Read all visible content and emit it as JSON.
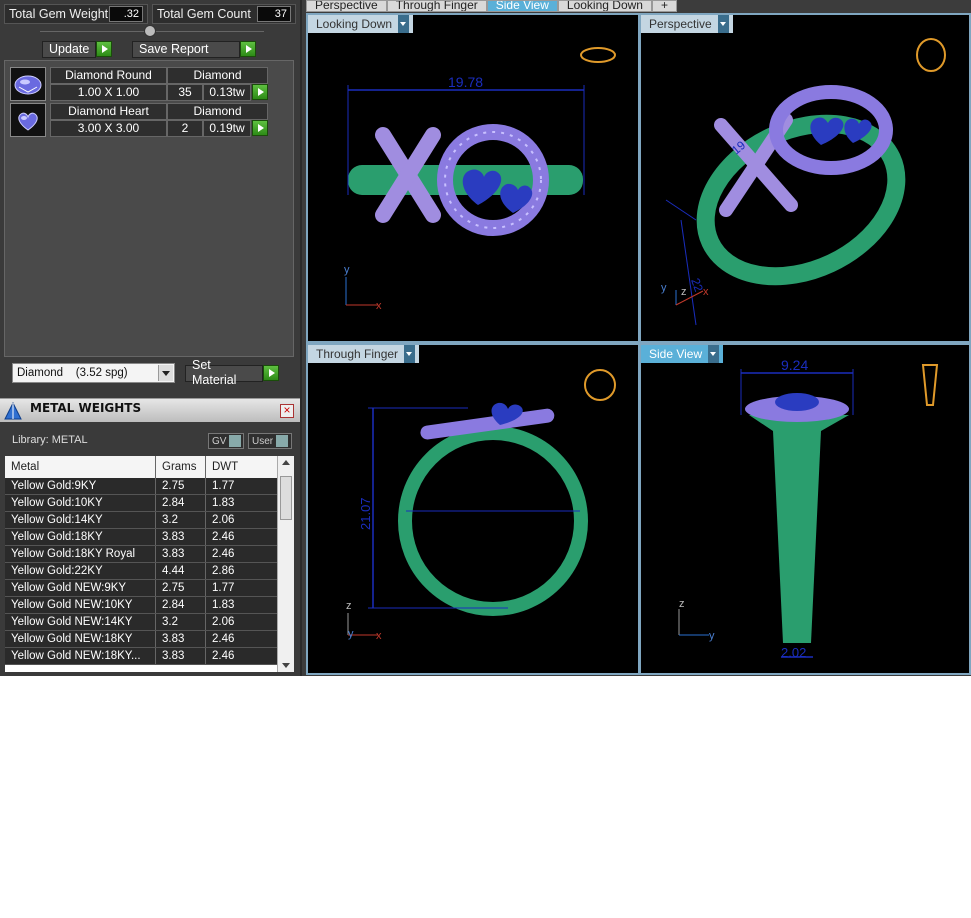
{
  "totals": {
    "weight_label": "Total Gem Weight",
    "weight_value": ".32",
    "count_label": "Total Gem Count",
    "count_value": "37"
  },
  "actions": {
    "update_label": "Update",
    "save_report_label": "Save Report"
  },
  "gems": [
    {
      "name": "Diamond Round",
      "material": "Diamond",
      "size": "1.00 X 1.00",
      "count": "35",
      "weight": "0.13tw"
    },
    {
      "name": "Diamond Heart",
      "material": "Diamond",
      "size": "3.00 X 3.00",
      "count": "2",
      "weight": "0.19tw"
    }
  ],
  "material_select": {
    "value": "Diamond    (3.52 spg)",
    "set_label": "Set Material"
  },
  "metal_weights": {
    "title": "METAL WEIGHTS",
    "library_label": "Library: METAL",
    "toggle_gv": "GV",
    "toggle_user": "User",
    "columns": [
      "Metal",
      "Grams",
      "DWT"
    ],
    "rows": [
      [
        "Yellow Gold:9KY",
        "2.75",
        "1.77"
      ],
      [
        "Yellow Gold:10KY",
        "2.84",
        "1.83"
      ],
      [
        "Yellow Gold:14KY",
        "3.2",
        "2.06"
      ],
      [
        "Yellow Gold:18KY",
        "3.83",
        "2.46"
      ],
      [
        "Yellow Gold:18KY Royal",
        "3.83",
        "2.46"
      ],
      [
        "Yellow Gold:22KY",
        "4.44",
        "2.86"
      ],
      [
        "Yellow Gold NEW:9KY",
        "2.75",
        "1.77"
      ],
      [
        "Yellow Gold NEW:10KY",
        "2.84",
        "1.83"
      ],
      [
        "Yellow Gold NEW:14KY",
        "3.2",
        "2.06"
      ],
      [
        "Yellow Gold NEW:18KY",
        "3.83",
        "2.46"
      ],
      [
        "Yellow Gold NEW:18KY...",
        "3.83",
        "2.46"
      ]
    ]
  },
  "tabs": [
    "Perspective",
    "Through Finger",
    "Side View",
    "Looking Down",
    "+"
  ],
  "active_tab": "Side View",
  "viewports": {
    "looking_down": {
      "label": "Looking Down",
      "dimension": "19.78",
      "axis_a": "y",
      "axis_b": "x"
    },
    "perspective": {
      "label": "Perspective",
      "dim_a": "19",
      "dim_b": "22",
      "axis_a": "y",
      "axis_b": "z",
      "axis_c": "x"
    },
    "through_finger": {
      "label": "Through Finger",
      "dimension": "21.07",
      "axis_a": "z",
      "axis_b": "y",
      "axis_c": "x"
    },
    "side_view": {
      "label": "Side View",
      "dim_top": "9.24",
      "dim_bottom": "2.02",
      "axis_a": "z",
      "axis_b": "y"
    }
  },
  "colors": {
    "metal": "#2a9e6e",
    "gem": "#5b5bd8",
    "dimension": "#1a2dbd",
    "highlight": "#5ab0d8"
  }
}
